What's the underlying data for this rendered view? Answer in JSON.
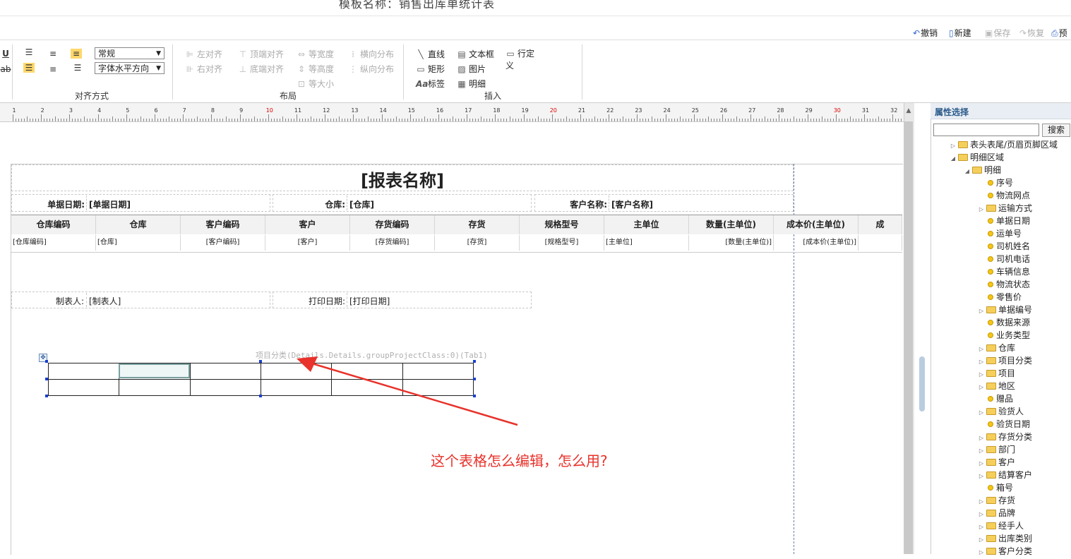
{
  "window": {
    "title": "模板名称：销售出库单统计表"
  },
  "quick_toolbar": {
    "undo": "撤销",
    "new": "新建",
    "save": "保存",
    "restore": "恢复",
    "preview": "预"
  },
  "ribbon": {
    "font_style_select": "常规",
    "text_dir_select": "字体水平方向",
    "align_group_label": "对齐方式",
    "layout": {
      "left_align": "左对齐",
      "top_align": "顶端对齐",
      "equal_width": "等宽度",
      "h_distribute": "横向分布",
      "right_align": "右对齐",
      "bottom_align": "底端对齐",
      "equal_height": "等高度",
      "v_distribute": "纵向分布",
      "equal_size": "等大小",
      "group_label": "布局"
    },
    "insert": {
      "line": "直线",
      "textbox": "文本框",
      "custom_row": "行定义",
      "rect": "矩形",
      "image": "图片",
      "label": "标签",
      "detail": "明细",
      "group_label": "插入"
    }
  },
  "ruler": {
    "marks": [
      "1",
      "2",
      "3",
      "4",
      "5",
      "6",
      "7",
      "8",
      "9",
      "10",
      "11",
      "12",
      "13",
      "14",
      "15",
      "16",
      "17",
      "18",
      "19",
      "20",
      "21",
      "22",
      "23",
      "24",
      "25",
      "26",
      "27",
      "28",
      "29",
      "30",
      "31",
      "32"
    ]
  },
  "report": {
    "title": "[报表名称]",
    "header_fields": [
      {
        "label": "单据日期:",
        "value": "[单据日期]"
      },
      {
        "label": "仓库:",
        "value": "[仓库]"
      },
      {
        "label": "客户名称:",
        "value": "[客户名称]"
      }
    ],
    "columns": [
      "仓库编码",
      "仓库",
      "客户编码",
      "客户",
      "存货编码",
      "存货",
      "规格型号",
      "主单位",
      "数量(主单位)",
      "成本价(主单位)",
      "成"
    ],
    "row": [
      "[仓库编码]",
      "[仓库]",
      "[客户编码]",
      "[客户]",
      "[存货编码]",
      "[存货]",
      "[规格型号]",
      "[主单位]",
      "[数量(主单位)]",
      "[成本价(主单位)]",
      ""
    ],
    "footer_fields": [
      {
        "label": "制表人:",
        "value": "[制表人]"
      },
      {
        "label": "打印日期:",
        "value": "[打印日期]"
      }
    ],
    "table_caption": "项目分类(Details.Details.groupProjectClass:0)(Tab1)"
  },
  "annotation": {
    "text": "这个表格怎么编辑，怎么用?",
    "color": "#e8322b"
  },
  "panel": {
    "title": "属性选择",
    "search_button": "搜索",
    "search_value": "",
    "tree": [
      {
        "label": "表头表尾/页眉页脚区域",
        "type": "folder",
        "level": 0,
        "state": "collapsed"
      },
      {
        "label": "明细区域",
        "type": "folder",
        "level": 0,
        "state": "expanded"
      },
      {
        "label": "明细",
        "type": "folder",
        "level": 1,
        "state": "expanded"
      },
      {
        "label": "序号",
        "type": "leaf",
        "level": 2
      },
      {
        "label": "物流网点",
        "type": "leaf",
        "level": 2
      },
      {
        "label": "运输方式",
        "type": "folder",
        "level": 2,
        "state": "collapsed"
      },
      {
        "label": "单据日期",
        "type": "leaf",
        "level": 2
      },
      {
        "label": "运单号",
        "type": "leaf",
        "level": 2
      },
      {
        "label": "司机姓名",
        "type": "leaf",
        "level": 2
      },
      {
        "label": "司机电话",
        "type": "leaf",
        "level": 2
      },
      {
        "label": "车辆信息",
        "type": "leaf",
        "level": 2
      },
      {
        "label": "物流状态",
        "type": "leaf",
        "level": 2
      },
      {
        "label": "零售价",
        "type": "leaf",
        "level": 2
      },
      {
        "label": "单据编号",
        "type": "folder",
        "level": 2,
        "state": "collapsed"
      },
      {
        "label": "数据来源",
        "type": "leaf",
        "level": 2
      },
      {
        "label": "业务类型",
        "type": "leaf",
        "level": 2
      },
      {
        "label": "仓库",
        "type": "folder",
        "level": 2,
        "state": "collapsed"
      },
      {
        "label": "项目分类",
        "type": "folder",
        "level": 2,
        "state": "collapsed"
      },
      {
        "label": "项目",
        "type": "folder",
        "level": 2,
        "state": "collapsed"
      },
      {
        "label": "地区",
        "type": "folder",
        "level": 2,
        "state": "collapsed"
      },
      {
        "label": "赠品",
        "type": "leaf",
        "level": 2
      },
      {
        "label": "验货人",
        "type": "folder",
        "level": 2,
        "state": "collapsed"
      },
      {
        "label": "验货日期",
        "type": "leaf",
        "level": 2
      },
      {
        "label": "存货分类",
        "type": "folder",
        "level": 2,
        "state": "collapsed"
      },
      {
        "label": "部门",
        "type": "folder",
        "level": 2,
        "state": "collapsed"
      },
      {
        "label": "客户",
        "type": "folder",
        "level": 2,
        "state": "collapsed"
      },
      {
        "label": "结算客户",
        "type": "folder",
        "level": 2,
        "state": "collapsed"
      },
      {
        "label": "箱号",
        "type": "leaf",
        "level": 2
      },
      {
        "label": "存货",
        "type": "folder",
        "level": 2,
        "state": "collapsed"
      },
      {
        "label": "品牌",
        "type": "folder",
        "level": 2,
        "state": "collapsed"
      },
      {
        "label": "经手人",
        "type": "folder",
        "level": 2,
        "state": "collapsed"
      },
      {
        "label": "出库类别",
        "type": "folder",
        "level": 2,
        "state": "collapsed"
      },
      {
        "label": "客户分类",
        "type": "folder",
        "level": 2,
        "state": "collapsed"
      }
    ]
  }
}
